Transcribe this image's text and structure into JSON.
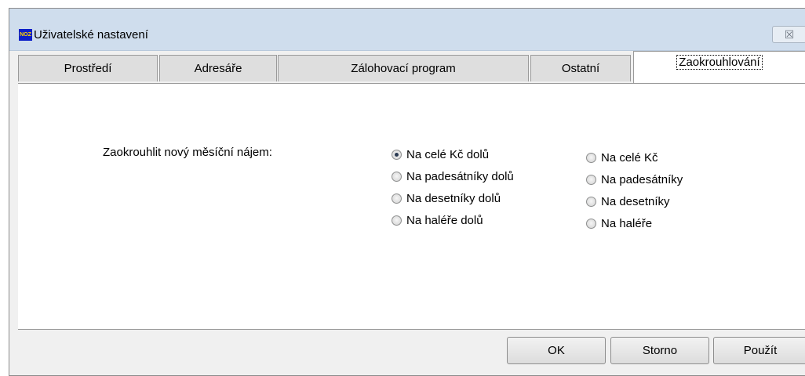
{
  "window": {
    "title": "Uživatelské nastavení",
    "icon_text": "NOZ",
    "close_glyph": "☒"
  },
  "tabs": [
    {
      "label": "Prostředí",
      "active": false
    },
    {
      "label": "Adresáře",
      "active": false
    },
    {
      "label": "Zálohovací program",
      "active": false
    },
    {
      "label": "Ostatní",
      "active": false
    },
    {
      "label": "Zaokrouhlování",
      "active": true
    }
  ],
  "rounding": {
    "label": "Zaokrouhlit nový měsíční nájem:",
    "left_options": [
      {
        "label": "Na celé Kč dolů",
        "selected": true
      },
      {
        "label": "Na padesátníky dolů",
        "selected": false
      },
      {
        "label": "Na desetníky dolů",
        "selected": false
      },
      {
        "label": "Na haléře dolů",
        "selected": false
      }
    ],
    "right_options": [
      {
        "label": "Na celé Kč",
        "selected": false
      },
      {
        "label": "Na padesátníky",
        "selected": false
      },
      {
        "label": "Na desetníky",
        "selected": false
      },
      {
        "label": "Na haléře",
        "selected": false
      }
    ]
  },
  "buttons": {
    "ok": "OK",
    "cancel": "Storno",
    "apply": "Použít"
  }
}
